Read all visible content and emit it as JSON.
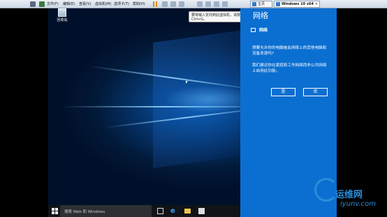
{
  "vmware": {
    "menu": [
      "文件(F)",
      "编辑(E)",
      "查看(V)",
      "虚拟机(M)",
      "选项卡(T)",
      "帮助(H)"
    ],
    "tabs": [
      {
        "label": "主页"
      },
      {
        "label": "Windows 10 x64"
      }
    ]
  },
  "tooltip": {
    "text": "要将输入定向到此虚拟机，请按 Ctrl+G。"
  },
  "desktop": {
    "recycle_bin_label": "回收站"
  },
  "network_flyout": {
    "title": "网络",
    "header_label": "网络",
    "question": "想要允许你的电脑被此网络上的其他电脑和设备发现吗?",
    "recommendation": "我们建议你在家庭和工作网络而非公共网络上启用此功能。",
    "yes_label": "是",
    "no_label": "否"
  },
  "taskbar": {
    "search_placeholder": "搜索 Web 和 Windows"
  },
  "watermark": {
    "site_name": "运维网",
    "domain": "iyunv.com"
  },
  "colors": {
    "flyout_bg": "#0b6fd1",
    "taskbar_bg": "#101318",
    "desktop_accent": "#0a5fb8"
  }
}
